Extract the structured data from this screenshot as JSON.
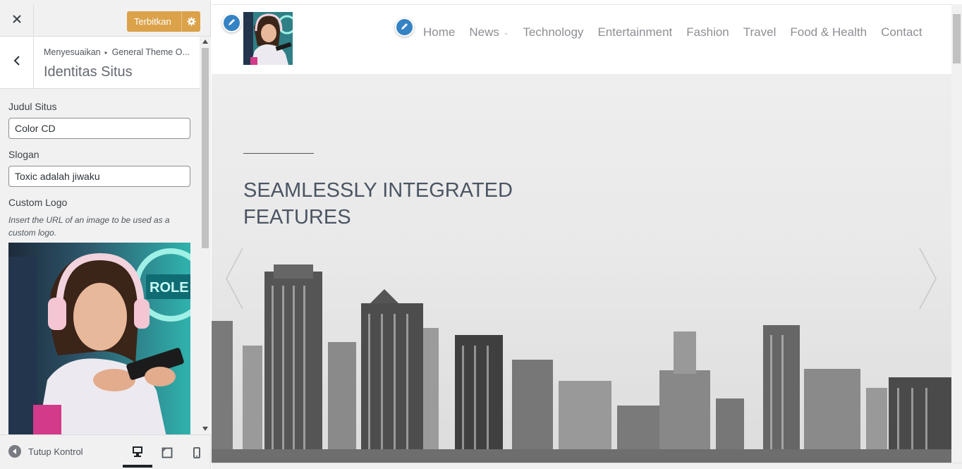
{
  "customizer": {
    "publish_label": "Terbitkan",
    "breadcrumb_root": "Menyesuaikan",
    "breadcrumb_section": "General Theme O...",
    "section_title": "Identitas Situs",
    "fields": {
      "site_title_label": "Judul Situs",
      "site_title_value": "Color CD",
      "tagline_label": "Slogan",
      "tagline_value": "Toxic adalah jiwaku",
      "logo_label": "Custom Logo",
      "logo_description": "Insert the URL of an image to be used as a custom logo."
    },
    "footer": {
      "collapse_label": "Tutup Kontrol",
      "devices": [
        "desktop",
        "tablet",
        "mobile"
      ],
      "active_device": "desktop"
    },
    "accent_color": "#dba24a",
    "edit_pin_color": "#3582c4"
  },
  "site": {
    "nav": [
      {
        "label": "Home"
      },
      {
        "label": "News",
        "has_dropdown": true
      },
      {
        "label": "Technology"
      },
      {
        "label": "Entertainment"
      },
      {
        "label": "Fashion"
      },
      {
        "label": "Travel"
      },
      {
        "label": "Food & Health"
      },
      {
        "label": "Contact"
      }
    ],
    "hero": {
      "title": "SEAMLESSLY INTEGRATED FEATURES"
    }
  },
  "icons": {
    "close": "close-icon",
    "publish_settings": "gear-icon",
    "back": "chevron-left-icon",
    "edit": "pencil-icon",
    "collapse": "arrow-left-circle-icon",
    "prev_slide": "chevron-left-icon",
    "next_slide": "chevron-right-icon"
  }
}
